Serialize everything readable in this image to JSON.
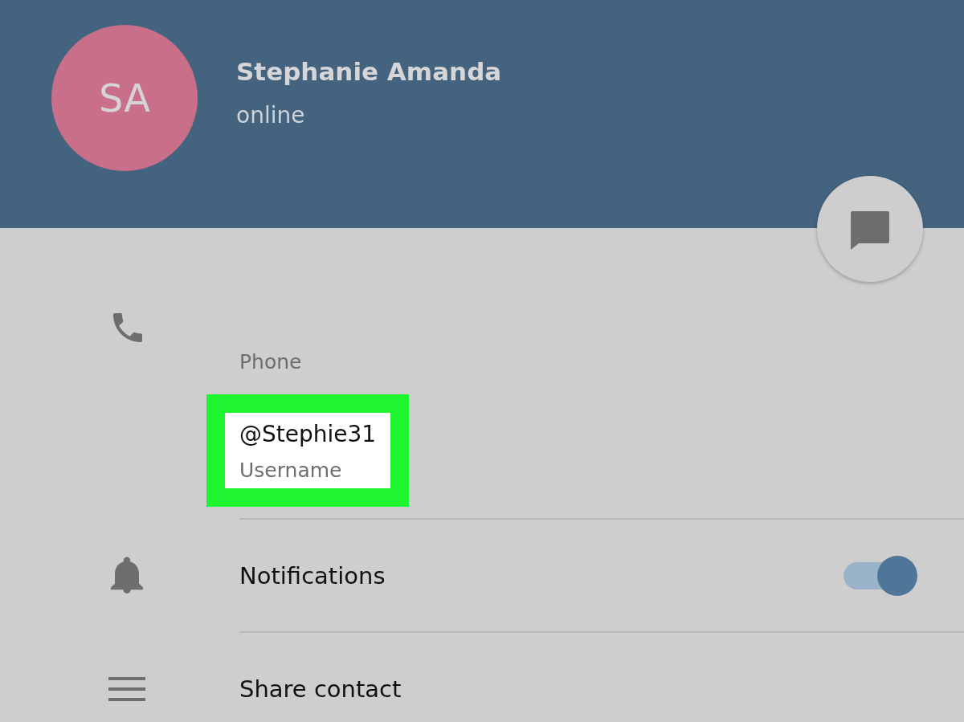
{
  "profile": {
    "avatar_initials": "SA",
    "name": "Stephanie Amanda",
    "status": "online"
  },
  "info": [
    {
      "kind": "label",
      "label": "Phone"
    },
    {
      "kind": "value",
      "value": "@Stephie31",
      "label": "Username",
      "highlighted": true
    }
  ],
  "settings": [
    {
      "kind": "toggle",
      "label": "Notifications",
      "on": true
    },
    {
      "kind": "action",
      "label": "Share contact"
    }
  ]
}
